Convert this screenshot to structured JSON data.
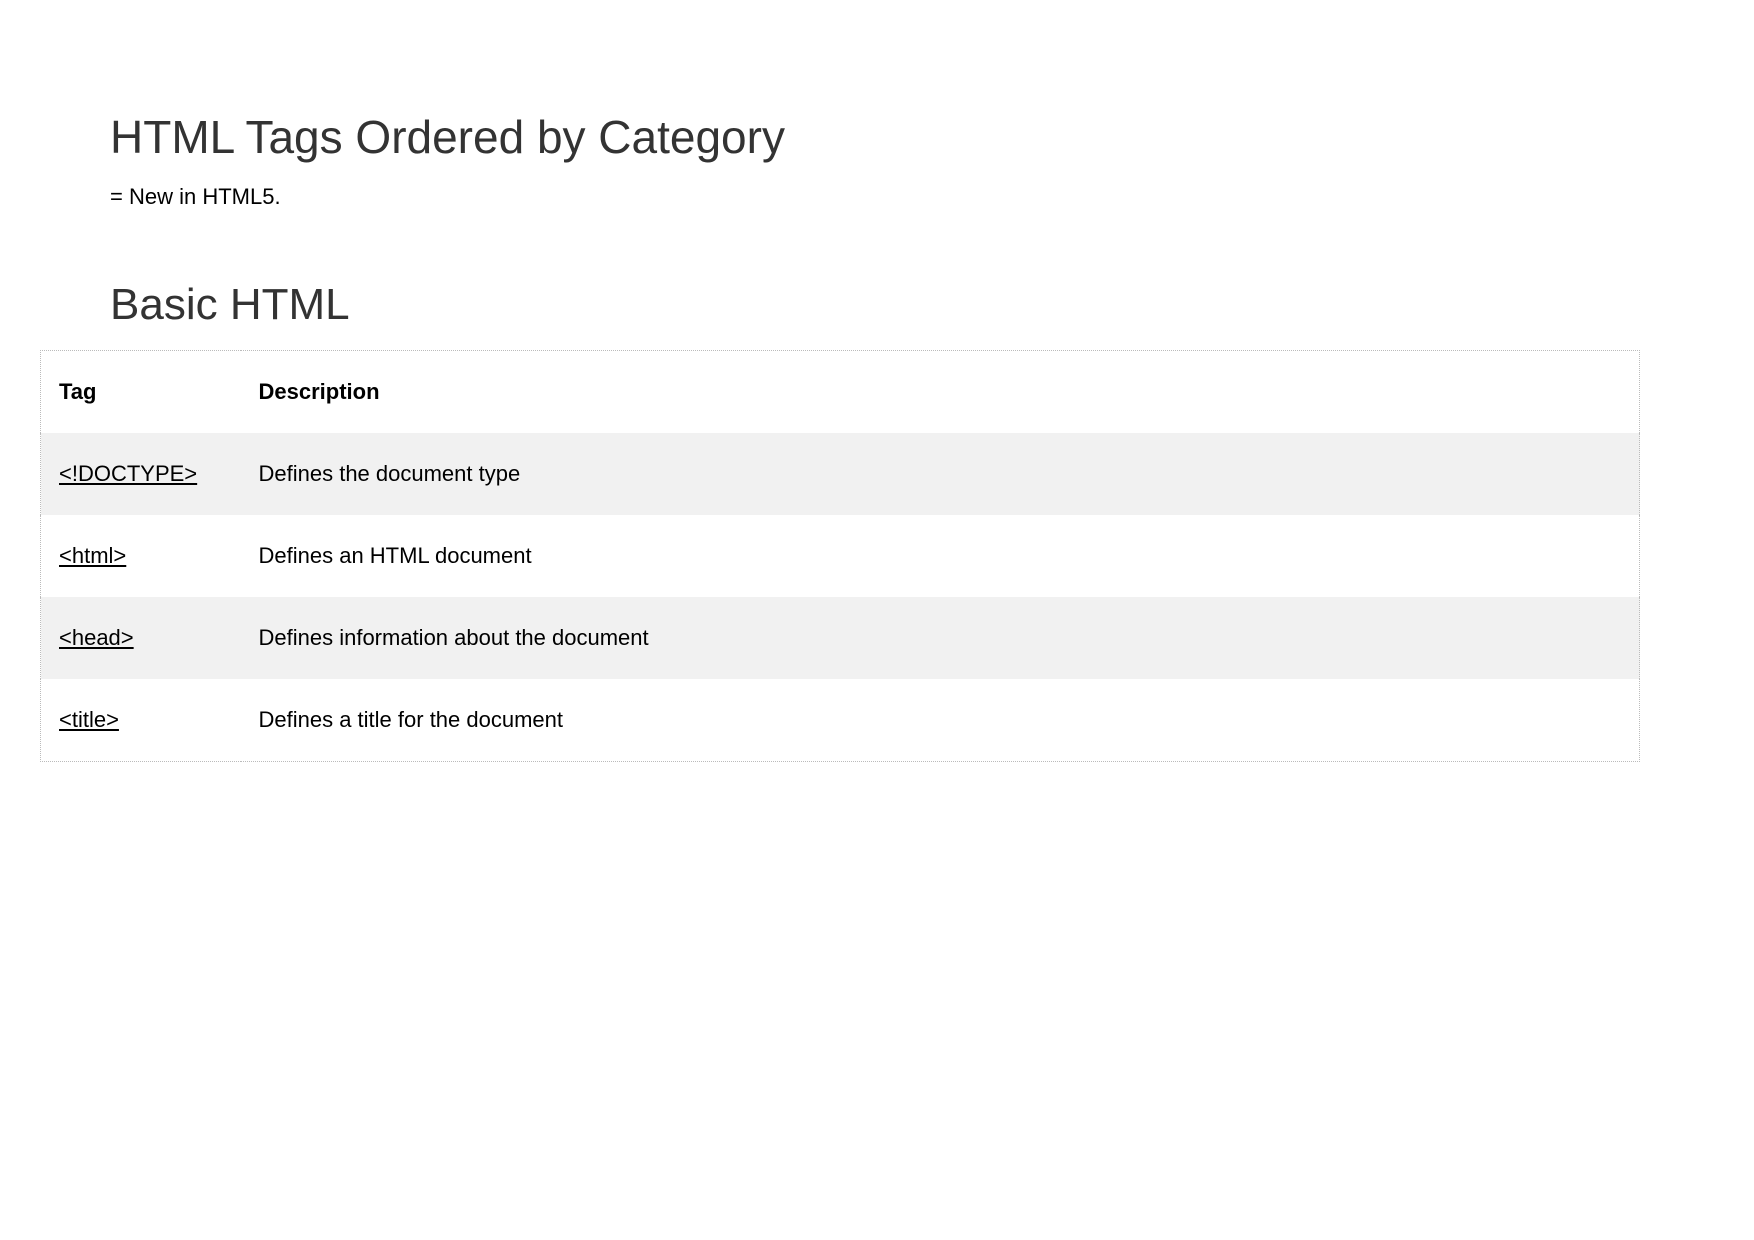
{
  "title": "HTML Tags Ordered by Category",
  "note": "= New in HTML5.",
  "section": "Basic HTML",
  "headers": {
    "tag": "Tag",
    "desc": "Description"
  },
  "rows": [
    {
      "tag": "<!DOCTYPE>",
      "desc": "Defines the document type"
    },
    {
      "tag": "<html>",
      "desc": "Defines an HTML document"
    },
    {
      "tag": "<head>",
      "desc": "Defines information about the document"
    },
    {
      "tag": "<title>",
      "desc": "Defines a title for the document"
    }
  ]
}
